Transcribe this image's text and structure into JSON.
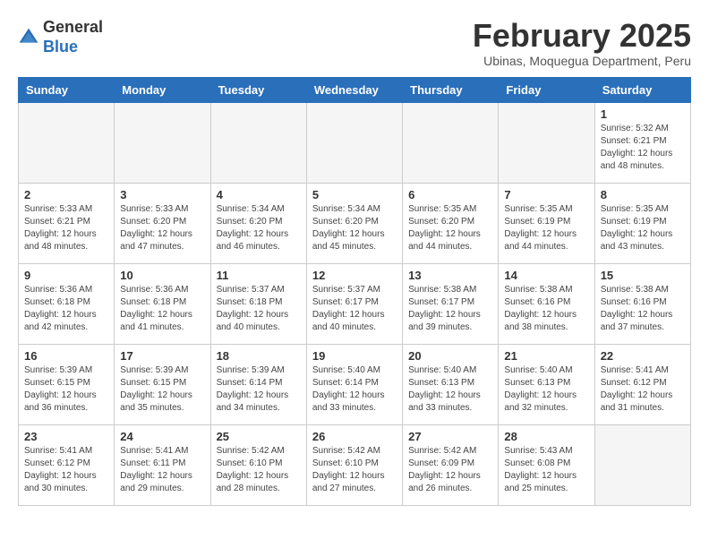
{
  "header": {
    "logo_general": "General",
    "logo_blue": "Blue",
    "title": "February 2025",
    "subtitle": "Ubinas, Moquegua Department, Peru"
  },
  "days_of_week": [
    "Sunday",
    "Monday",
    "Tuesday",
    "Wednesday",
    "Thursday",
    "Friday",
    "Saturday"
  ],
  "weeks": [
    [
      {
        "day": "",
        "info": ""
      },
      {
        "day": "",
        "info": ""
      },
      {
        "day": "",
        "info": ""
      },
      {
        "day": "",
        "info": ""
      },
      {
        "day": "",
        "info": ""
      },
      {
        "day": "",
        "info": ""
      },
      {
        "day": "1",
        "info": "Sunrise: 5:32 AM\nSunset: 6:21 PM\nDaylight: 12 hours\nand 48 minutes."
      }
    ],
    [
      {
        "day": "2",
        "info": "Sunrise: 5:33 AM\nSunset: 6:21 PM\nDaylight: 12 hours\nand 48 minutes."
      },
      {
        "day": "3",
        "info": "Sunrise: 5:33 AM\nSunset: 6:20 PM\nDaylight: 12 hours\nand 47 minutes."
      },
      {
        "day": "4",
        "info": "Sunrise: 5:34 AM\nSunset: 6:20 PM\nDaylight: 12 hours\nand 46 minutes."
      },
      {
        "day": "5",
        "info": "Sunrise: 5:34 AM\nSunset: 6:20 PM\nDaylight: 12 hours\nand 45 minutes."
      },
      {
        "day": "6",
        "info": "Sunrise: 5:35 AM\nSunset: 6:20 PM\nDaylight: 12 hours\nand 44 minutes."
      },
      {
        "day": "7",
        "info": "Sunrise: 5:35 AM\nSunset: 6:19 PM\nDaylight: 12 hours\nand 44 minutes."
      },
      {
        "day": "8",
        "info": "Sunrise: 5:35 AM\nSunset: 6:19 PM\nDaylight: 12 hours\nand 43 minutes."
      }
    ],
    [
      {
        "day": "9",
        "info": "Sunrise: 5:36 AM\nSunset: 6:18 PM\nDaylight: 12 hours\nand 42 minutes."
      },
      {
        "day": "10",
        "info": "Sunrise: 5:36 AM\nSunset: 6:18 PM\nDaylight: 12 hours\nand 41 minutes."
      },
      {
        "day": "11",
        "info": "Sunrise: 5:37 AM\nSunset: 6:18 PM\nDaylight: 12 hours\nand 40 minutes."
      },
      {
        "day": "12",
        "info": "Sunrise: 5:37 AM\nSunset: 6:17 PM\nDaylight: 12 hours\nand 40 minutes."
      },
      {
        "day": "13",
        "info": "Sunrise: 5:38 AM\nSunset: 6:17 PM\nDaylight: 12 hours\nand 39 minutes."
      },
      {
        "day": "14",
        "info": "Sunrise: 5:38 AM\nSunset: 6:16 PM\nDaylight: 12 hours\nand 38 minutes."
      },
      {
        "day": "15",
        "info": "Sunrise: 5:38 AM\nSunset: 6:16 PM\nDaylight: 12 hours\nand 37 minutes."
      }
    ],
    [
      {
        "day": "16",
        "info": "Sunrise: 5:39 AM\nSunset: 6:15 PM\nDaylight: 12 hours\nand 36 minutes."
      },
      {
        "day": "17",
        "info": "Sunrise: 5:39 AM\nSunset: 6:15 PM\nDaylight: 12 hours\nand 35 minutes."
      },
      {
        "day": "18",
        "info": "Sunrise: 5:39 AM\nSunset: 6:14 PM\nDaylight: 12 hours\nand 34 minutes."
      },
      {
        "day": "19",
        "info": "Sunrise: 5:40 AM\nSunset: 6:14 PM\nDaylight: 12 hours\nand 33 minutes."
      },
      {
        "day": "20",
        "info": "Sunrise: 5:40 AM\nSunset: 6:13 PM\nDaylight: 12 hours\nand 33 minutes."
      },
      {
        "day": "21",
        "info": "Sunrise: 5:40 AM\nSunset: 6:13 PM\nDaylight: 12 hours\nand 32 minutes."
      },
      {
        "day": "22",
        "info": "Sunrise: 5:41 AM\nSunset: 6:12 PM\nDaylight: 12 hours\nand 31 minutes."
      }
    ],
    [
      {
        "day": "23",
        "info": "Sunrise: 5:41 AM\nSunset: 6:12 PM\nDaylight: 12 hours\nand 30 minutes."
      },
      {
        "day": "24",
        "info": "Sunrise: 5:41 AM\nSunset: 6:11 PM\nDaylight: 12 hours\nand 29 minutes."
      },
      {
        "day": "25",
        "info": "Sunrise: 5:42 AM\nSunset: 6:10 PM\nDaylight: 12 hours\nand 28 minutes."
      },
      {
        "day": "26",
        "info": "Sunrise: 5:42 AM\nSunset: 6:10 PM\nDaylight: 12 hours\nand 27 minutes."
      },
      {
        "day": "27",
        "info": "Sunrise: 5:42 AM\nSunset: 6:09 PM\nDaylight: 12 hours\nand 26 minutes."
      },
      {
        "day": "28",
        "info": "Sunrise: 5:43 AM\nSunset: 6:08 PM\nDaylight: 12 hours\nand 25 minutes."
      },
      {
        "day": "",
        "info": ""
      }
    ]
  ]
}
